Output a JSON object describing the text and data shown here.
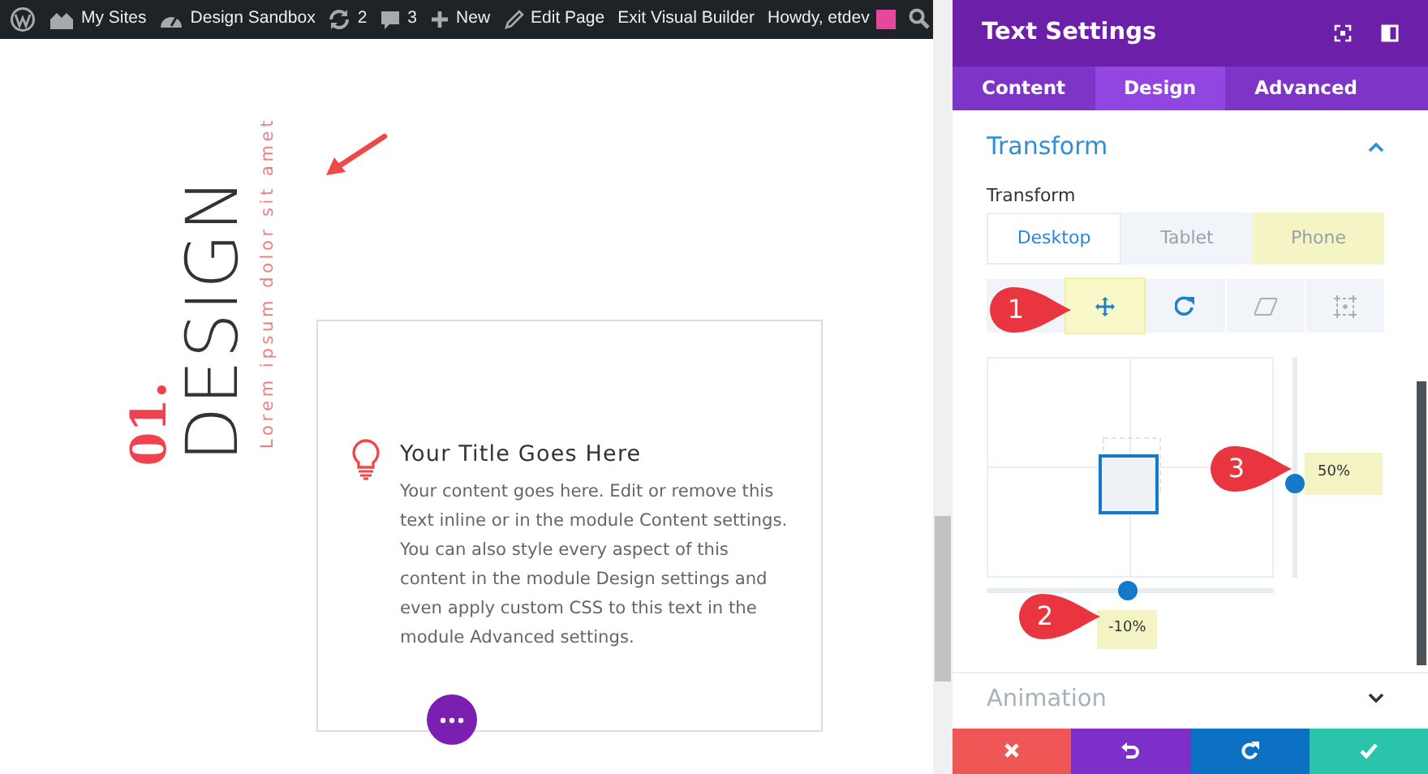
{
  "admin_bar": {
    "items": [
      {
        "kind": "wordpress"
      },
      {
        "kind": "sites",
        "label": "My Sites"
      },
      {
        "kind": "dashboard",
        "label": "Design Sandbox"
      },
      {
        "kind": "updates",
        "label": "2"
      },
      {
        "kind": "comments",
        "label": "3"
      },
      {
        "kind": "new",
        "label": "New"
      },
      {
        "kind": "edit",
        "label": "Edit Page"
      },
      {
        "kind": "text",
        "label": "Exit Visual Builder"
      },
      {
        "kind": "account",
        "label": "Howdy, etdev"
      },
      {
        "kind": "search"
      }
    ]
  },
  "page": {
    "number": "01.",
    "heading": "DESIGN",
    "subheading": "Lorem ipsum dolor sit amet",
    "blurb": {
      "title": "Your Title Goes Here",
      "body": "Your content goes here. Edit or remove this text inline or in the module Content settings. You can also style every aspect of this content in the module Design settings and even apply custom CSS to this text in the module Advanced settings."
    }
  },
  "panel": {
    "title": "Text Settings",
    "tabs": [
      {
        "label": "Content",
        "selected": false
      },
      {
        "label": "Design",
        "selected": true
      },
      {
        "label": "Advanced",
        "selected": false
      }
    ],
    "section": {
      "title": "Transform",
      "expanded": true,
      "field_label": "Transform",
      "devices": [
        {
          "label": "Desktop",
          "selected": true,
          "highlighted": false
        },
        {
          "label": "Tablet",
          "selected": false,
          "highlighted": false
        },
        {
          "label": "Phone",
          "selected": false,
          "highlighted": true
        }
      ],
      "tools": [
        {
          "kind": "move",
          "selected": true,
          "highlighted": true
        },
        {
          "kind": "rotate",
          "selected": false,
          "highlighted": false
        },
        {
          "kind": "skew",
          "selected": false,
          "highlighted": false
        },
        {
          "kind": "origin",
          "selected": false,
          "highlighted": false
        }
      ],
      "horizontal_slider": {
        "level": 0.49,
        "reading": "-10%"
      },
      "vertical_slider": {
        "level": 0.43,
        "reading": "50%"
      }
    },
    "collapsed_section": {
      "title": "Animation",
      "expanded": false
    },
    "footer": [
      {
        "kind": "cancel"
      },
      {
        "kind": "undo"
      },
      {
        "kind": "redo"
      },
      {
        "kind": "save"
      }
    ]
  },
  "callouts": [
    {
      "label": "1"
    },
    {
      "label": "2"
    },
    {
      "label": "3"
    }
  ]
}
